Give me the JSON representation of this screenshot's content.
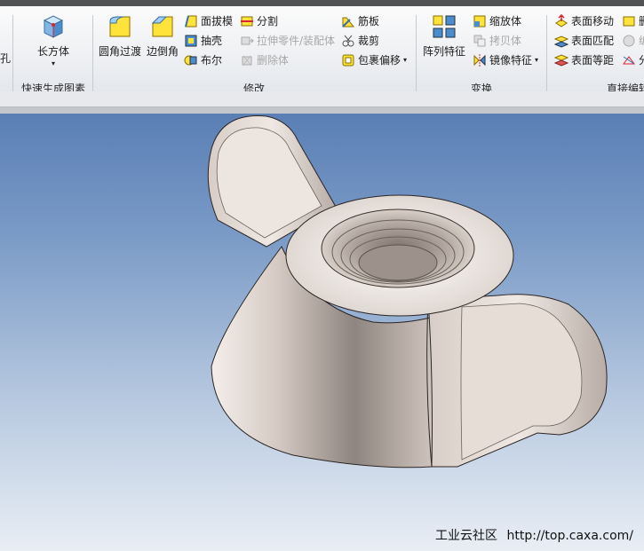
{
  "ribbon": {
    "hole_partial": "孔",
    "quick_group": {
      "box_label": "长方体",
      "title": "快速生成图素"
    },
    "modify_group": {
      "title": "修改",
      "fillet_label": "圆角过渡",
      "chamfer_label": "边倒角",
      "draft_label": "面拔模",
      "shell_label": "抽壳",
      "boolean_label": "布尔",
      "split_label": "分割",
      "stretch_label": "拉伸零件/装配体",
      "delete_label": "删除体",
      "rib_label": "筋板",
      "trim_label": "裁剪",
      "wrap_offset_label": "包裹偏移"
    },
    "transform_group": {
      "title": "变换",
      "pattern_label": "阵列特征",
      "scale_label": "缩放体",
      "copy_label": "拷贝体",
      "mirror_label": "镜像特征"
    },
    "direct_edit_group": {
      "title": "直接编辑",
      "face_move_label": "表面移动",
      "face_match_label": "表面匹配",
      "face_offset_label": "表面等距",
      "delete_partial": "删",
      "partial_b": "编",
      "split_partial": "分"
    }
  },
  "viewport": {
    "model": "wing-nut",
    "watermark_site": "工业云社区",
    "watermark_url": "http://top.caxa.com/"
  },
  "colors": {
    "ribbon_bg": "#eef0f3",
    "viewport_top": "#5a7fb5",
    "viewport_bottom": "#e9eef5",
    "model_body": "#c9bfb8"
  }
}
